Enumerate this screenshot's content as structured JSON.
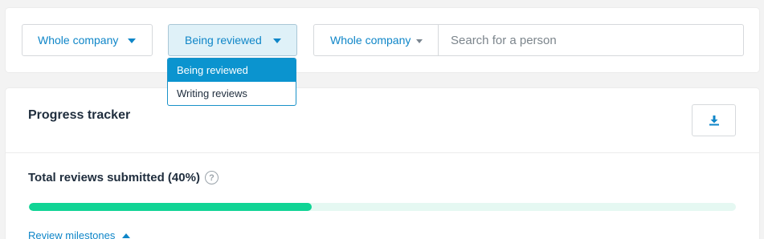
{
  "filters": {
    "scope": {
      "label": "Whole company"
    },
    "status": {
      "label": "Being reviewed",
      "options": [
        {
          "label": "Being reviewed",
          "selected": true
        },
        {
          "label": "Writing reviews",
          "selected": false
        }
      ]
    },
    "search": {
      "scope_label": "Whole company",
      "placeholder": "Search for a person",
      "value": ""
    }
  },
  "progress": {
    "title": "Progress tracker",
    "download_icon": "download-icon",
    "total_label": "Total reviews submitted (40%)",
    "help_icon": "?",
    "percent": 40,
    "milestones_label": "Review milestones"
  },
  "colors": {
    "accent": "#0f86c8",
    "progress_fill": "#10d495",
    "progress_track": "#e5f8f2",
    "selected_option": "#0b94cf"
  }
}
